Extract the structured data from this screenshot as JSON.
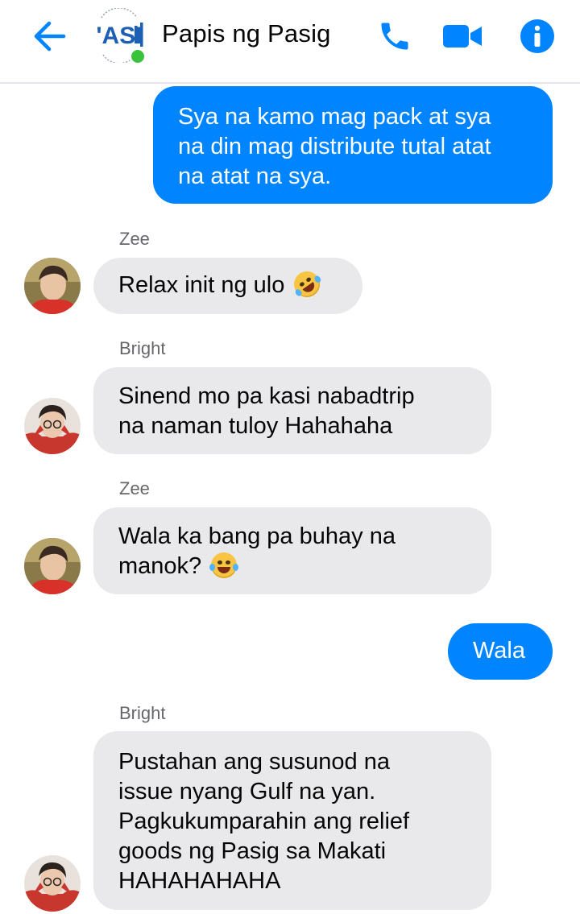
{
  "header": {
    "title": "Papis ng Pasig",
    "group_logo_text": "'ASI",
    "back_icon": "back-arrow-icon",
    "call_icon": "phone-icon",
    "video_icon": "video-camera-icon",
    "info_icon": "info-icon",
    "accent_color": "#0084ff",
    "online_color": "#3ac23a"
  },
  "messages": [
    {
      "direction": "outgoing",
      "lines": [
        "Sya na kamo mag pack at sya",
        "na din mag distribute tutal atat",
        "na atat na sya."
      ]
    },
    {
      "direction": "incoming",
      "sender": "Zee",
      "lines": [
        "Relax init ng ulo"
      ],
      "emoji": "rolling-on-floor-laughing-emoji"
    },
    {
      "direction": "incoming",
      "sender": "Bright",
      "lines": [
        "Sinend mo pa kasi nabadtrip",
        "na naman tuloy Hahahaha"
      ]
    },
    {
      "direction": "incoming",
      "sender": "Zee",
      "lines": [
        "Wala ka bang pa buhay na",
        "manok?"
      ],
      "emoji": "face-with-tears-of-joy-emoji"
    },
    {
      "direction": "outgoing",
      "lines": [
        "Wala"
      ]
    },
    {
      "direction": "incoming",
      "sender": "Bright",
      "lines": [
        "Pustahan ang susunod na",
        "issue nyang Gulf na yan.",
        "Pagkukumparahin ang relief",
        "goods ng Pasig sa Makati",
        "HAHAHAHAHA"
      ]
    }
  ],
  "colors": {
    "outgoing_bubble": "#0084ff",
    "incoming_bubble": "#e9e9eb",
    "sender_name": "#65676b"
  }
}
